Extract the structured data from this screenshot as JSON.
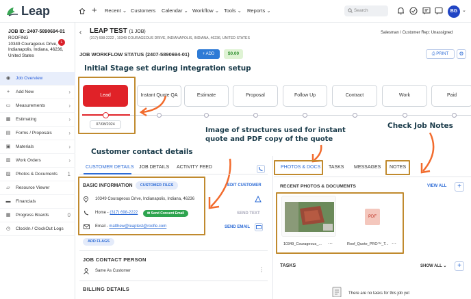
{
  "nav": {
    "logo_text": "Leap",
    "items": [
      "Recent",
      "Customers",
      "Calendar",
      "Workflow",
      "Tools",
      "Reports"
    ],
    "search_placeholder": "Search",
    "avatar_initials": "BG"
  },
  "job": {
    "id": "JOB ID: 2407-5890694-01",
    "type": "ROOFING",
    "badge": "L",
    "address_line1": "10349 Courageous Drive,",
    "address_line2": "Indianapolis, Indiana, 46236,",
    "address_line3": "United States"
  },
  "sidebar": {
    "items": [
      {
        "label": "Job Overview",
        "chev": ""
      },
      {
        "label": "Add New",
        "chev": "›"
      },
      {
        "label": "Measurements",
        "chev": "›"
      },
      {
        "label": "Estimating",
        "chev": "›"
      },
      {
        "label": "Forms / Proposals",
        "chev": "›"
      },
      {
        "label": "Materials",
        "chev": "›"
      },
      {
        "label": "Work Orders",
        "chev": "›"
      },
      {
        "label": "Photos & Documents",
        "chev": "1"
      },
      {
        "label": "Resource Viewer",
        "chev": ""
      },
      {
        "label": "Financials",
        "chev": ""
      },
      {
        "label": "Progress Boards",
        "chev": "0"
      },
      {
        "label": "ClockIn / ClockOut Logs",
        "chev": ""
      }
    ]
  },
  "header": {
    "title": "LEAP TEST",
    "title_count": "(1 JOB)",
    "subtitle": "(317) 698-2222 , 10349 COURAGEOUS DRIVE, INDIANAPOLIS, INDIANA, 46236, UNITED STATES",
    "salesman": "Salesman / Customer Rep: Unassigned",
    "workflow_status": "JOB WORKFLOW STATUS (2407-5890694-01)",
    "add_label": "+ ADD",
    "amount": "$0.00",
    "print_label": "PRINT"
  },
  "stages": [
    "Lead",
    "Instant Quote QA",
    "Estimate",
    "Proposal",
    "Follow Up",
    "Contract",
    "Work",
    "Paid"
  ],
  "stage_date": "07/08/2024",
  "annotations": {
    "initial_stage": "Initial Stage set during integration setup",
    "customer_contact": "Customer contact details",
    "image_structures_1": "Image of structures used for instant",
    "image_structures_2": "quote and PDF copy of the quote",
    "check_notes": "Check Job Notes"
  },
  "left_tabs": [
    "CUSTOMER DETAILS",
    "JOB DETAILS",
    "ACTIVITY FEED"
  ],
  "basic_info": {
    "title": "BASIC INFORMATION",
    "customer_files": "CUSTOMER FILES",
    "edit_customer": "EDIT CUSTOMER",
    "address": "10349 Courageous Drive, Indianapolis, Indiana, 46236",
    "home_label": "Home - ",
    "home_phone": "(317) 698-2222",
    "consent_label": "Send Consent Email",
    "email_label": "Email - ",
    "email": "matthew@leaptest@roofle.com",
    "send_text": "SEND TEXT",
    "send_email": "SEND EMAIL",
    "add_flags": "ADD FLAGS"
  },
  "job_contact": {
    "title": "JOB CONTACT PERSON",
    "value": "Same As Customer"
  },
  "billing": {
    "title": "BILLING DETAILS"
  },
  "right_tabs": [
    "PHOTOS & DOCS",
    "TASKS",
    "MESSAGES",
    "NOTES"
  ],
  "recent": {
    "title": "RECENT PHOTOS & DOCUMENTS",
    "view_all": "VIEW ALL",
    "files": [
      "10349_Courageous_...",
      "Roof_Quote_PRO™_T..."
    ],
    "pdf_label": "PDF"
  },
  "tasks": {
    "title": "TASKS",
    "show_all": "SHOW ALL",
    "empty": "There are no tasks for this job yet"
  }
}
